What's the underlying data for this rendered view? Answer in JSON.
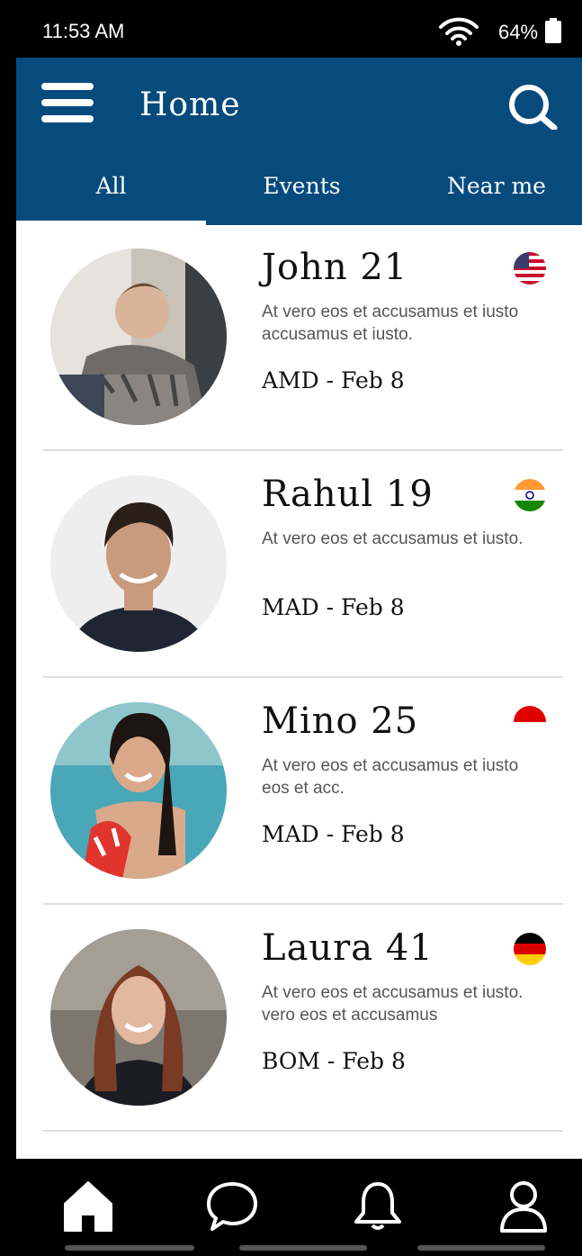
{
  "status_bar": {
    "time": "11:53 AM",
    "battery": "64%",
    "wifi_icon": "wifi-icon",
    "battery_icon": "battery-icon"
  },
  "app_bar": {
    "title": "Home",
    "menu_icon": "hamburger-menu-icon",
    "search_icon": "search-icon",
    "color": "#074B7D"
  },
  "tabs": [
    {
      "label": "All",
      "active": true
    },
    {
      "label": "Events",
      "active": false
    },
    {
      "label": "Near me",
      "active": false
    }
  ],
  "people": [
    {
      "name": "John 21",
      "description": "At vero eos et accusamus et iusto accusamus et iusto.",
      "meta": "AMD - Feb 8",
      "flag": "usa-flag-icon"
    },
    {
      "name": "Rahul 19",
      "description": "At vero eos et accusamus et iusto.",
      "meta": "MAD - Feb 8",
      "flag": "india-flag-icon"
    },
    {
      "name": "Mino 25",
      "description": "At vero eos et accusamus et iusto eos et acc.",
      "meta": "MAD - Feb 8",
      "flag": "indonesia-flag-icon"
    },
    {
      "name": "Laura 41",
      "description": "At vero eos et accusamus et iusto. vero eos et accusamus",
      "meta": "BOM - Feb 8",
      "flag": "germany-flag-icon"
    }
  ],
  "bottom_nav": [
    {
      "icon": "home-icon",
      "active": true
    },
    {
      "icon": "chat-bubble-icon",
      "active": false
    },
    {
      "icon": "bell-icon",
      "active": false
    },
    {
      "icon": "profile-icon",
      "active": false
    }
  ]
}
